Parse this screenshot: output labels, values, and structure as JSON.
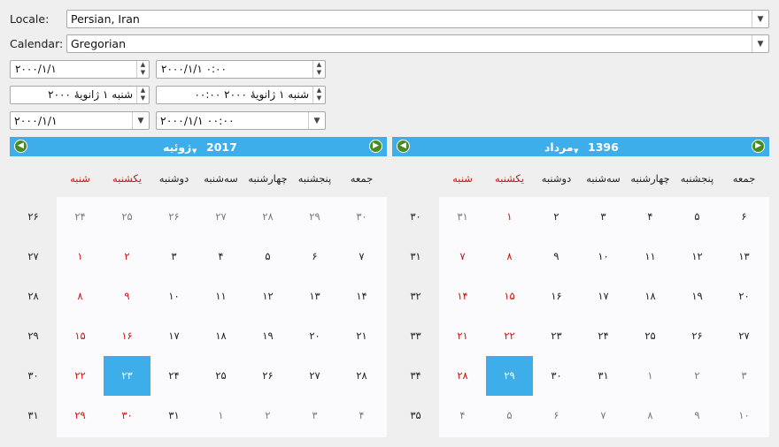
{
  "form": {
    "locale_label": "Locale:",
    "locale_value": "Persian, Iran",
    "calendar_label": "Calendar:",
    "calendar_value": "Gregorian",
    "date_spin": "۲۰۰۰/۱/۱",
    "datetime_spin": "۲۰۰۰/۱/۱ ۰:۰۰",
    "longdate_spin": "شنبه ۱ ژانویهٔ ۲۰۰۰",
    "longdatetime_spin": "شنبه ۱ ژانویهٔ ۲۰۰۰ ۰۰:۰۰",
    "date_combo": "۲۰۰۰/۱/۱",
    "datetime_combo": "۲۰۰۰/۱/۱ ۰۰:۰۰"
  },
  "calendar_left": {
    "month": "ژوئیه",
    "year": "2017",
    "weekday_headers": [
      "شنبه",
      "یکشنبه",
      "دوشنبه",
      "سه‌شنبه",
      "چهارشنبه",
      "پنجشنبه",
      "جمعه"
    ],
    "week_numbers": [
      "۲۶",
      "۲۷",
      "۲۸",
      "۲۹",
      "۳۰",
      "۳۱"
    ],
    "weeks": [
      [
        "۲۴",
        "۲۵",
        "۲۶",
        "۲۷",
        "۲۸",
        "۲۹",
        "۳۰"
      ],
      [
        "۱",
        "۲",
        "۳",
        "۴",
        "۵",
        "۶",
        "۷"
      ],
      [
        "۸",
        "۹",
        "۱۰",
        "۱۱",
        "۱۲",
        "۱۳",
        "۱۴"
      ],
      [
        "۱۵",
        "۱۶",
        "۱۷",
        "۱۸",
        "۱۹",
        "۲۰",
        "۲۱"
      ],
      [
        "۲۲",
        "۲۳",
        "۲۴",
        "۲۵",
        "۲۶",
        "۲۷",
        "۲۸"
      ],
      [
        "۲۹",
        "۳۰",
        "۳۱",
        "۱",
        "۲",
        "۳",
        "۴"
      ]
    ],
    "selected": "۲۳"
  },
  "calendar_right": {
    "month": "مرداد",
    "year": "1396",
    "weekday_headers": [
      "شنبه",
      "یکشنبه",
      "دوشنبه",
      "سه‌شنبه",
      "چهارشنبه",
      "پنجشنبه",
      "جمعه"
    ],
    "week_numbers": [
      "۳۰",
      "۳۱",
      "۳۲",
      "۳۳",
      "۳۴",
      "۳۵"
    ],
    "weeks": [
      [
        "۳۱",
        "۱",
        "۲",
        "۳",
        "۴",
        "۵",
        "۶"
      ],
      [
        "۷",
        "۸",
        "۹",
        "۱۰",
        "۱۱",
        "۱۲",
        "۱۳"
      ],
      [
        "۱۴",
        "۱۵",
        "۱۶",
        "۱۷",
        "۱۸",
        "۱۹",
        "۲۰"
      ],
      [
        "۲۱",
        "۲۲",
        "۲۳",
        "۲۴",
        "۲۵",
        "۲۶",
        "۲۷"
      ],
      [
        "۲۸",
        "۲۹",
        "۳۰",
        "۳۱",
        "۱",
        "۲",
        "۳"
      ],
      [
        "۴",
        "۵",
        "۶",
        "۷",
        "۸",
        "۹",
        "۱۰"
      ]
    ],
    "selected": "۲۹"
  },
  "colors": {
    "accent": "#3daee9",
    "weekend": "#d01010",
    "nav_button": "#4a8a1f"
  },
  "icons": {
    "nav_prev": "green-arrow-left-icon",
    "nav_next": "green-arrow-right-icon"
  }
}
